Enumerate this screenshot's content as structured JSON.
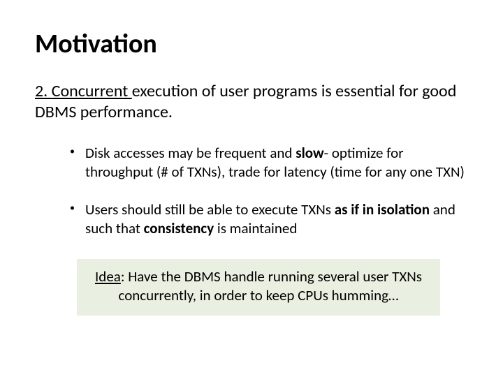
{
  "title": "Motivation",
  "lead": {
    "num": "2. ",
    "word": "Concurrent ",
    "rest": "execution of user programs is essential for good DBMS performance."
  },
  "bullets": [
    {
      "pre": "Disk accesses may be frequent and ",
      "b1": "slow",
      "post": "- optimize for throughput (# of TXNs), trade for latency (time for any one TXN)"
    },
    {
      "pre": "Users should still be able to execute TXNs ",
      "b1": "as if in isolation ",
      "mid": "and such that ",
      "b2": "consistency ",
      "post": "is maintained"
    }
  ],
  "idea": {
    "label": "Idea",
    "text": ": Have the DBMS handle running several user TXNs concurrently, in order to keep CPUs humming…"
  }
}
